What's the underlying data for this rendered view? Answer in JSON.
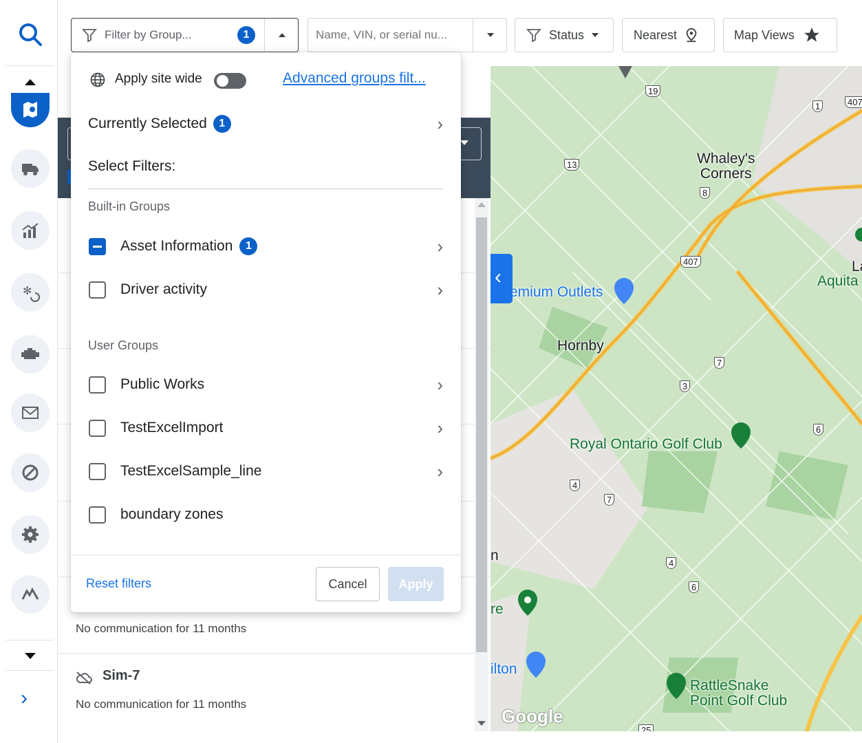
{
  "topbar": {
    "group_filter_placeholder": "Filter by Group...",
    "group_filter_count": "1",
    "search_placeholder": "Name, VIN, or serial nu...",
    "status_label": "Status",
    "nearest_label": "Nearest",
    "map_views_label": "Map Views"
  },
  "panel": {
    "apply_site_wide": "Apply site wide",
    "advanced_link": "Advanced groups filt...",
    "currently_selected": "Currently Selected",
    "currently_selected_count": "1",
    "select_filters": "Select Filters:",
    "builtin_header": "Built-in Groups",
    "builtin": [
      {
        "label": "Asset Information",
        "count": "1"
      },
      {
        "label": "Driver activity"
      }
    ],
    "user_header": "User Groups",
    "user": [
      {
        "label": "Public Works"
      },
      {
        "label": "TestExcelImport"
      },
      {
        "label": "TestExcelSample_line"
      },
      {
        "label": "boundary zones"
      }
    ],
    "reset": "Reset filters",
    "cancel": "Cancel",
    "apply": "Apply"
  },
  "list": {
    "items": [
      {
        "status": "No communication for 11 months"
      },
      {
        "name": "Sim-7",
        "status": "No communication for 11 months"
      }
    ]
  },
  "map": {
    "labels": {
      "whaleys": "Whaley's\nCorners",
      "outlets": "emium Outlets",
      "hornby": "Hornby",
      "golf1": "Royal Ontario Golf Club",
      "golf2": "RattleSnake\nPoint Golf Club",
      "aquita": "Aquita",
      "la": "La",
      "ilton": "ilton",
      "re": "re",
      "n": "n",
      "google": "Google"
    },
    "roads": [
      "19",
      "1",
      "407",
      "13",
      "8",
      "407",
      "7",
      "3",
      "6",
      "4",
      "7",
      "4",
      "6",
      "25"
    ]
  },
  "colors": {
    "accent": "#0c61c9",
    "map_bg": "#cde5c5",
    "highway": "#f6c44a"
  }
}
